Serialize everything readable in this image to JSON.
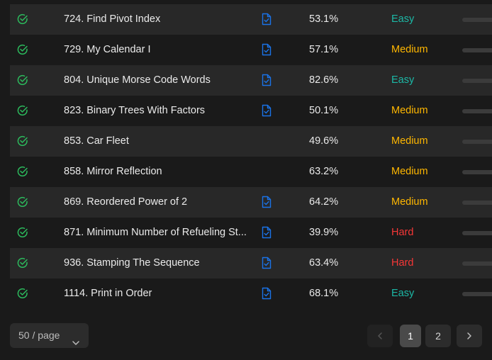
{
  "colors": {
    "easy": "#1cb8a6",
    "medium": "#ffb700",
    "hard": "#f63737",
    "check": "#2cbb5d",
    "solution_icon": "#1a73e8"
  },
  "problems": [
    {
      "title": "724. Find Pivot Index",
      "has_solution": true,
      "acceptance": "53.1%",
      "difficulty": "Easy"
    },
    {
      "title": "729. My Calendar I",
      "has_solution": true,
      "acceptance": "57.1%",
      "difficulty": "Medium"
    },
    {
      "title": "804. Unique Morse Code Words",
      "has_solution": true,
      "acceptance": "82.6%",
      "difficulty": "Easy"
    },
    {
      "title": "823. Binary Trees With Factors",
      "has_solution": true,
      "acceptance": "50.1%",
      "difficulty": "Medium"
    },
    {
      "title": "853. Car Fleet",
      "has_solution": false,
      "acceptance": "49.6%",
      "difficulty": "Medium"
    },
    {
      "title": "858. Mirror Reflection",
      "has_solution": false,
      "acceptance": "63.2%",
      "difficulty": "Medium"
    },
    {
      "title": "869. Reordered Power of 2",
      "has_solution": true,
      "acceptance": "64.2%",
      "difficulty": "Medium"
    },
    {
      "title": "871. Minimum Number of Refueling St...",
      "has_solution": true,
      "acceptance": "39.9%",
      "difficulty": "Hard"
    },
    {
      "title": "936. Stamping The Sequence",
      "has_solution": true,
      "acceptance": "63.4%",
      "difficulty": "Hard"
    },
    {
      "title": "1114. Print in Order",
      "has_solution": true,
      "acceptance": "68.1%",
      "difficulty": "Easy"
    }
  ],
  "pagination": {
    "page_size_label": "50 / page",
    "pages": [
      "1",
      "2"
    ],
    "current_page": "1"
  }
}
